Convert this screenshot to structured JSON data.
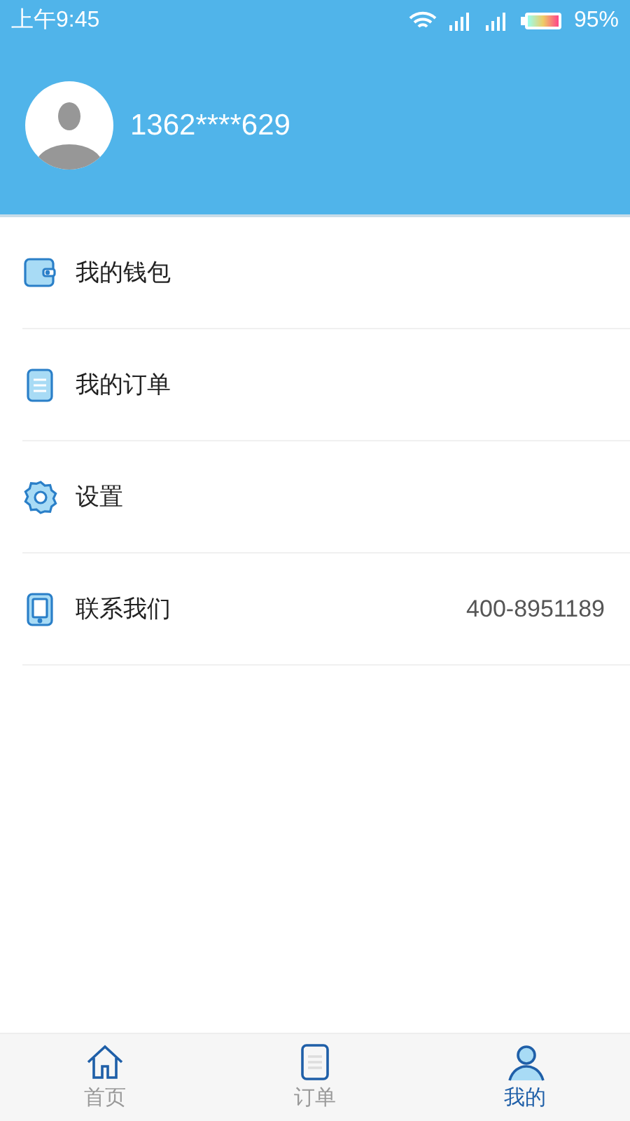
{
  "status_bar": {
    "time": "上午9:45",
    "battery": "95%"
  },
  "profile": {
    "phone": "1362****629"
  },
  "menu": [
    {
      "kind": "wallet",
      "label": "我的钱包"
    },
    {
      "kind": "order",
      "label": "我的订单"
    },
    {
      "kind": "settings",
      "label": "设置"
    },
    {
      "kind": "contact",
      "label": "联系我们",
      "value": "400-8951189"
    }
  ],
  "tabs": [
    {
      "kind": "home",
      "label": "首页",
      "selected": false
    },
    {
      "kind": "order",
      "label": "订单",
      "selected": false
    },
    {
      "kind": "me",
      "label": "我的",
      "selected": true
    }
  ]
}
